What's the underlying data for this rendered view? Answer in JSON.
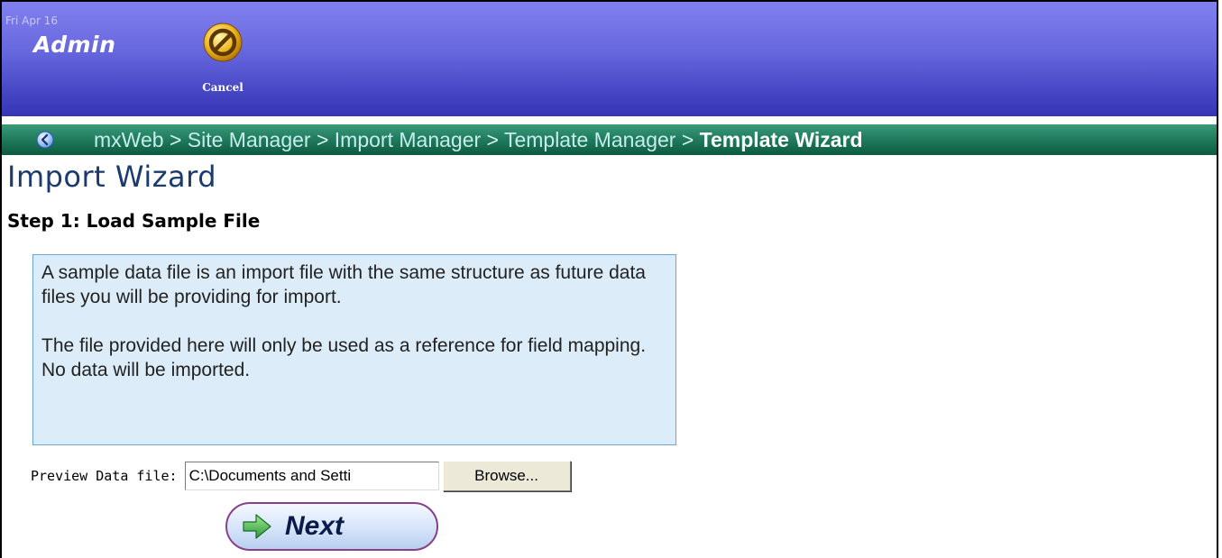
{
  "header": {
    "date": "Fri Apr 16",
    "app_title": "Admin",
    "cancel_label": "Cancel"
  },
  "breadcrumb": {
    "items": [
      "mxWeb",
      "Site Manager",
      "Import Manager",
      "Template Manager"
    ],
    "separator": ">",
    "current": "Template Wizard"
  },
  "page": {
    "title": "Import Wizard",
    "step": "Step 1: Load Sample File"
  },
  "info": {
    "paragraph1": "A sample data file is an import file with the same structure as future data files you will be providing for import.",
    "paragraph2": "The file provided here will only be used as a reference for field mapping. No data will be imported."
  },
  "file": {
    "label": "Preview Data file:",
    "value": "C:\\Documents and Setti",
    "browse_label": "Browse..."
  },
  "next_label": "Next",
  "colors": {
    "banner": "#6a6ae0",
    "breadcrumb_bar": "#1f7a5c",
    "info_bg": "#dcecf8",
    "title": "#1a3a70"
  },
  "icons": {
    "cancel": "cancel-icon",
    "back": "back-arrow-icon",
    "next": "right-arrow-icon"
  }
}
